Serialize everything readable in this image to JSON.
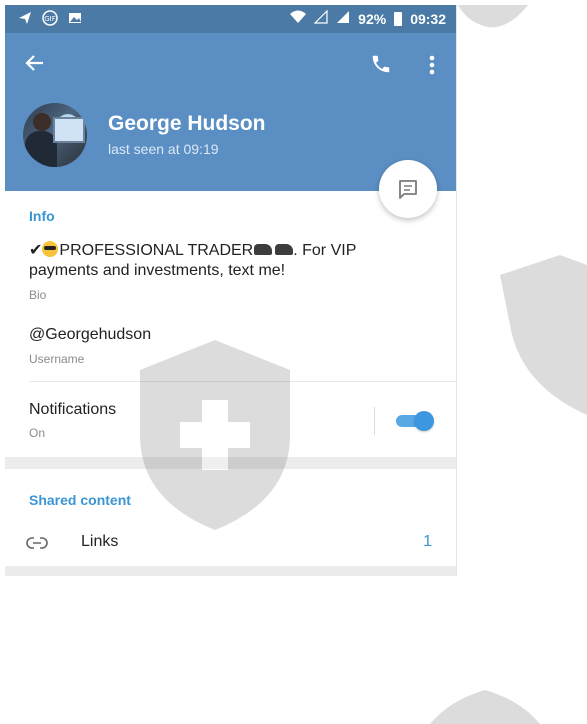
{
  "status_bar": {
    "battery": "92%",
    "time": "09:32",
    "icons": [
      "navigation-icon",
      "gif-icon",
      "image-icon",
      "wifi-icon",
      "no-sim-icon",
      "signal-icon",
      "battery-icon"
    ]
  },
  "header": {
    "name": "George Hudson",
    "last_seen": "last seen at 09:19",
    "bg_color": "#5b8fc3"
  },
  "info": {
    "title": "Info",
    "bio_text_1": "PROFESSIONAL TRADER",
    "bio_text_2": ". For VIP payments and investments, text me!",
    "bio_label": "Bio",
    "username": "@Georgehudson",
    "username_label": "Username",
    "notifications_label": "Notifications",
    "notifications_state": "On",
    "notifications_enabled": true
  },
  "shared": {
    "title": "Shared content",
    "links_label": "Links",
    "links_count": "1"
  },
  "colors": {
    "accent": "#3a95d5",
    "status_bar": "#4a7aa5"
  }
}
